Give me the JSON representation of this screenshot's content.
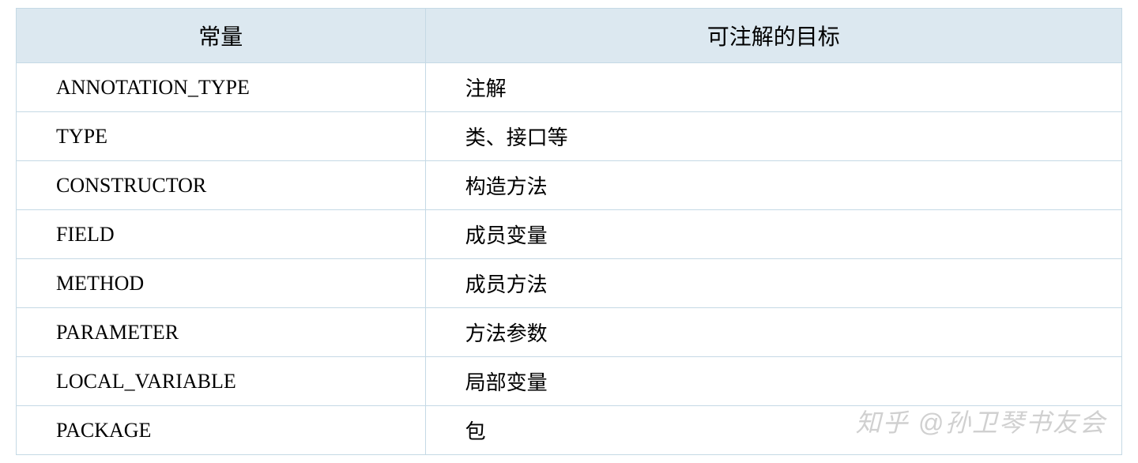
{
  "table": {
    "headers": {
      "constant": "常量",
      "target": "可注解的目标"
    },
    "rows": [
      {
        "constant": "ANNOTATION_TYPE",
        "target": "注解"
      },
      {
        "constant": "TYPE",
        "target": "类、接口等"
      },
      {
        "constant": "CONSTRUCTOR",
        "target": "构造方法"
      },
      {
        "constant": "FIELD",
        "target": "成员变量"
      },
      {
        "constant": "METHOD",
        "target": "成员方法"
      },
      {
        "constant": "PARAMETER",
        "target": "方法参数"
      },
      {
        "constant": "LOCAL_VARIABLE",
        "target": "局部变量"
      },
      {
        "constant": "PACKAGE",
        "target": "包"
      }
    ]
  },
  "watermark": "知乎 @孙卫琴书友会"
}
